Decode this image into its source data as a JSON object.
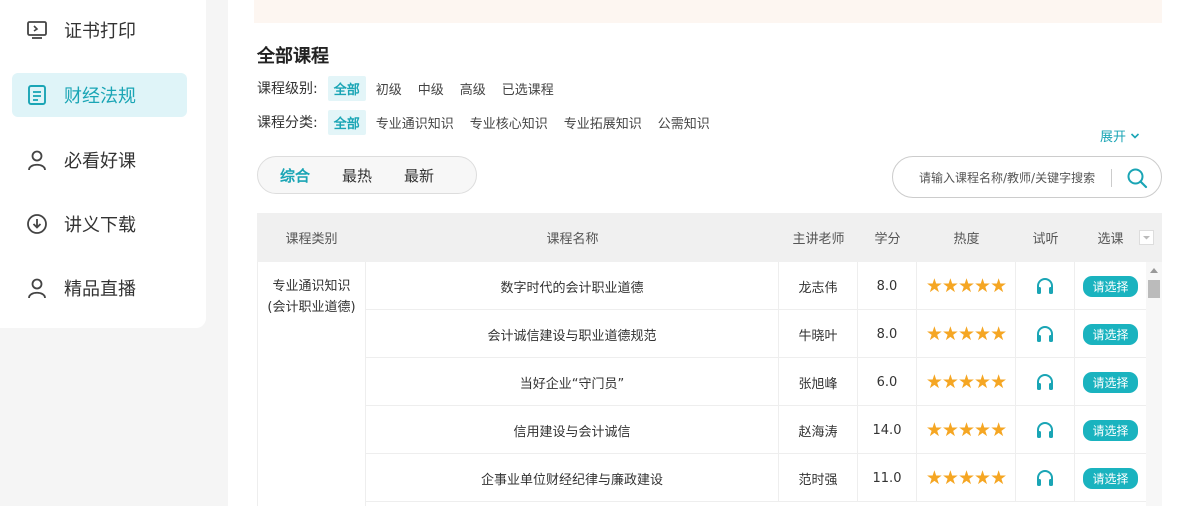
{
  "sidebar": {
    "items": [
      {
        "label": "证书打印",
        "icon": "monitor-icon",
        "active": false
      },
      {
        "label": "财经法规",
        "icon": "document-icon",
        "active": true
      },
      {
        "label": "必看好课",
        "icon": "user-icon",
        "active": false
      },
      {
        "label": "讲义下载",
        "icon": "download-icon",
        "active": false
      },
      {
        "label": "精品直播",
        "icon": "user-icon",
        "active": false
      }
    ]
  },
  "main": {
    "title": "全部课程",
    "level_filter": {
      "label": "课程级别:",
      "options": [
        "全部",
        "初级",
        "中级",
        "高级",
        "已选课程"
      ],
      "selected": "全部"
    },
    "category_filter": {
      "label": "课程分类:",
      "options": [
        "全部",
        "专业通识知识",
        "专业核心知识",
        "专业拓展知识",
        "公需知识"
      ],
      "selected": "全部"
    },
    "expand_label": "展开",
    "sort_tabs": [
      "综合",
      "最热",
      "最新"
    ],
    "sort_selected": "综合",
    "search": {
      "placeholder": "请输入课程名称/教师/关键字搜索"
    }
  },
  "table": {
    "headers": {
      "category": "课程类别",
      "name": "课程名称",
      "teacher": "主讲老师",
      "credit": "学分",
      "hot": "热度",
      "trial": "试听",
      "select": "选课"
    },
    "category_line1": "专业通识知识",
    "category_line2": "(会计职业道德)",
    "rows": [
      {
        "name": "数字时代的会计职业道德",
        "teacher": "龙志伟",
        "credit": "8.0",
        "stars": 5,
        "action": "请选择"
      },
      {
        "name": "会计诚信建设与职业道德规范",
        "teacher": "牛晓叶",
        "credit": "8.0",
        "stars": 5,
        "action": "请选择"
      },
      {
        "name": "当好企业“守门员”",
        "teacher": "张旭峰",
        "credit": "6.0",
        "stars": 5,
        "action": "请选择"
      },
      {
        "name": "信用建设与会计诚信",
        "teacher": "赵海涛",
        "credit": "14.0",
        "stars": 5,
        "action": "请选择"
      },
      {
        "name": "企事业单位财经纪律与廉政建设",
        "teacher": "范时强",
        "credit": "11.0",
        "stars": 5,
        "action": "请选择"
      }
    ]
  },
  "colors": {
    "accent": "#1aa5b5",
    "star": "#f5a623",
    "active_bg": "#dff4f8"
  }
}
